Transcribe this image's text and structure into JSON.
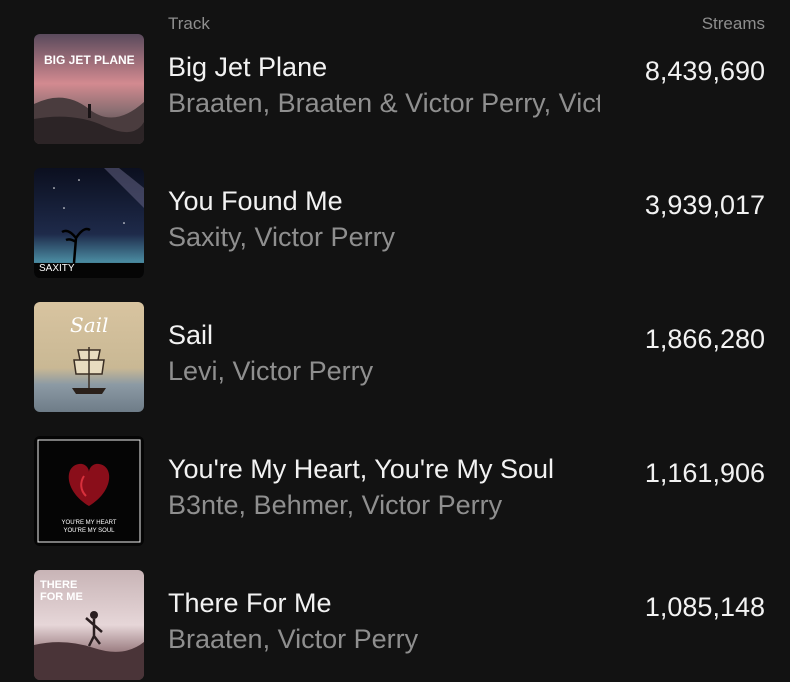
{
  "header": {
    "track_label": "Track",
    "streams_label": "Streams"
  },
  "tracks": [
    {
      "title": "Big Jet Plane",
      "artists": "Braaten, Braaten & Victor Perry, Victor Perry",
      "streams": "8,439,690",
      "art_text": "BIG JET PLANE"
    },
    {
      "title": "You Found Me",
      "artists": "Saxity, Victor Perry",
      "streams": "3,939,017",
      "art_text": "SAXITY"
    },
    {
      "title": "Sail",
      "artists": "Levi, Victor Perry",
      "streams": "1,866,280",
      "art_text": "Sail"
    },
    {
      "title": "You're My Heart, You're My Soul",
      "artists": "B3nte, Behmer, Victor Perry",
      "streams": "1,161,906",
      "art_text": "YOU'RE MY HEART YOU'RE MY SOUL"
    },
    {
      "title": "There For Me",
      "artists": "Braaten, Victor Perry",
      "streams": "1,085,148",
      "art_text": "THERE FOR ME"
    }
  ]
}
